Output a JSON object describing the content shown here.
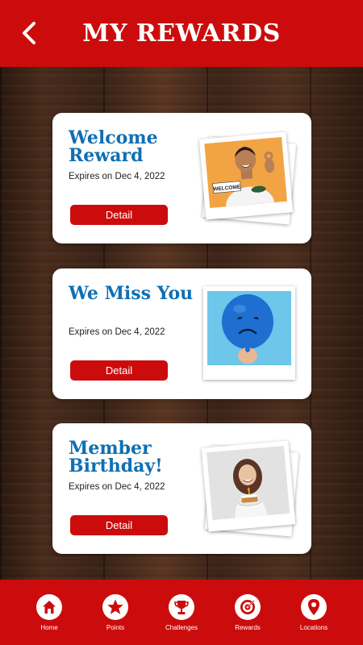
{
  "header": {
    "title": "MY REWARDS",
    "back_icon": "chevron-left-icon"
  },
  "rewards": [
    {
      "title": "Welcome Reward",
      "expiry": "Expires on Dec 4, 2022",
      "button_label": "Detail",
      "photo": "smiling man holding WELCOME sign",
      "photo_sign_text": "WELCOME"
    },
    {
      "title": "We Miss You",
      "expiry": "Expires on Dec 4, 2022",
      "button_label": "Detail",
      "photo": "blue balloon with sad face"
    },
    {
      "title": "Member Birthday!",
      "expiry": "Expires on Dec 4, 2022",
      "button_label": "Detail",
      "photo": "smiling woman holding birthday cake"
    }
  ],
  "nav": [
    {
      "label": "Home",
      "icon": "home-icon"
    },
    {
      "label": "Points",
      "icon": "star-icon"
    },
    {
      "label": "Challenges",
      "icon": "trophy-icon"
    },
    {
      "label": "Rewards",
      "icon": "target-icon"
    },
    {
      "label": "Locations",
      "icon": "location-pin-icon"
    }
  ],
  "colors": {
    "brand_red": "#cc0c0c",
    "title_blue": "#0f6fb3",
    "card_bg": "#ffffff"
  }
}
